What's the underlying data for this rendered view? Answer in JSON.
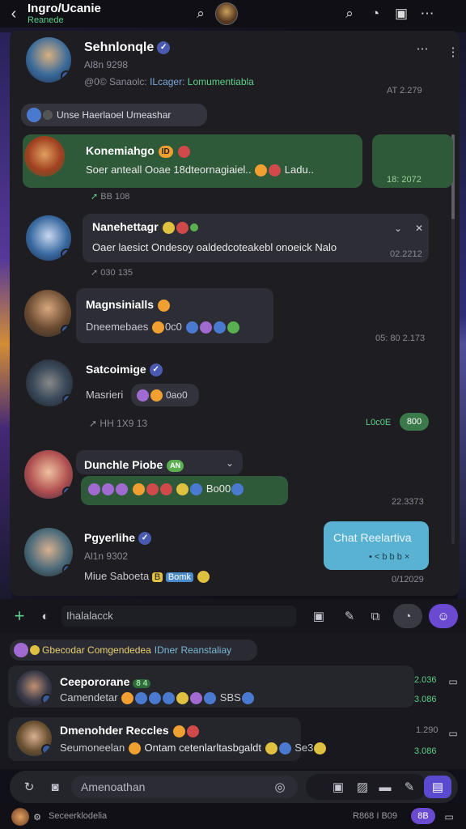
{
  "topbar": {
    "title": "Ingro/Ucanie",
    "subtitle": "Reanede"
  },
  "header": {
    "name": "Sehnlonqle",
    "line2": "Al8n 9298",
    "line3_prefix": "@0© Sanaolc:",
    "line3_mid": "ILcager",
    "line3_green": "Lomumentiabla",
    "time": "AT 2.279"
  },
  "pinned": {
    "label": "Unse Haerlaoel Umeashar"
  },
  "messages": [
    {
      "name": "Konemiahgo",
      "tag": "ID",
      "text": "Soer anteall Ooae 18dteornagiaiel.. ",
      "text2": "Ladu..",
      "reply_time": "BB 108",
      "side_time": "18: 2072"
    },
    {
      "name": "Nanehettagr",
      "text": "Oaer laesict Ondesoy oaldedcoteakebl onoeick Nalo",
      "time": "02.2212",
      "meta": "030 135"
    },
    {
      "name": "Magnsinialls",
      "text": "Dneemebaes",
      "text_tail": "0c0",
      "time": "05: 80 2.173"
    },
    {
      "name": "Satcoimige",
      "text": "Masrieri",
      "pill": "0ao0",
      "meta": "HH 1X9 13",
      "status_green": "L0c0E",
      "status_badge": "800",
      "time": ""
    },
    {
      "name": "Dunchle Piobe",
      "tag": "AN",
      "text_tail": "Bo00",
      "time": "22.3373"
    },
    {
      "name": "Pgyerlihe",
      "line2": "Al1n 9302",
      "line3": "Miue Saboeta",
      "tag_y": "B",
      "tag_b": "Bomk",
      "out_title": "Chat Reelartiva",
      "out_meta": "• < b b b ×",
      "time": "0/12029"
    }
  ],
  "input": {
    "placeholder": "Ihalalacck"
  },
  "lower": {
    "banner": "Gbecodar Comgendedea",
    "banner_tail": "IDner Reanstaliay",
    "items": [
      {
        "name": "Ceepororane",
        "tag": "8 4",
        "text": "Camendetar",
        "text_tail": "SBS",
        "time": "2.036",
        "time2": "3.086"
      },
      {
        "name": "Dmenohder Reccles",
        "text": "Seumoneelan",
        "text_mid": "Ontam cetenlarltasbgaldt",
        "text_tail": "Se3",
        "time": "1.290",
        "time2": "3.086"
      }
    ]
  },
  "compose": {
    "placeholder": "Amenoathan"
  },
  "footer": {
    "label": "Seceerklodelia",
    "right": "R868 I B09",
    "badge": "8B"
  }
}
